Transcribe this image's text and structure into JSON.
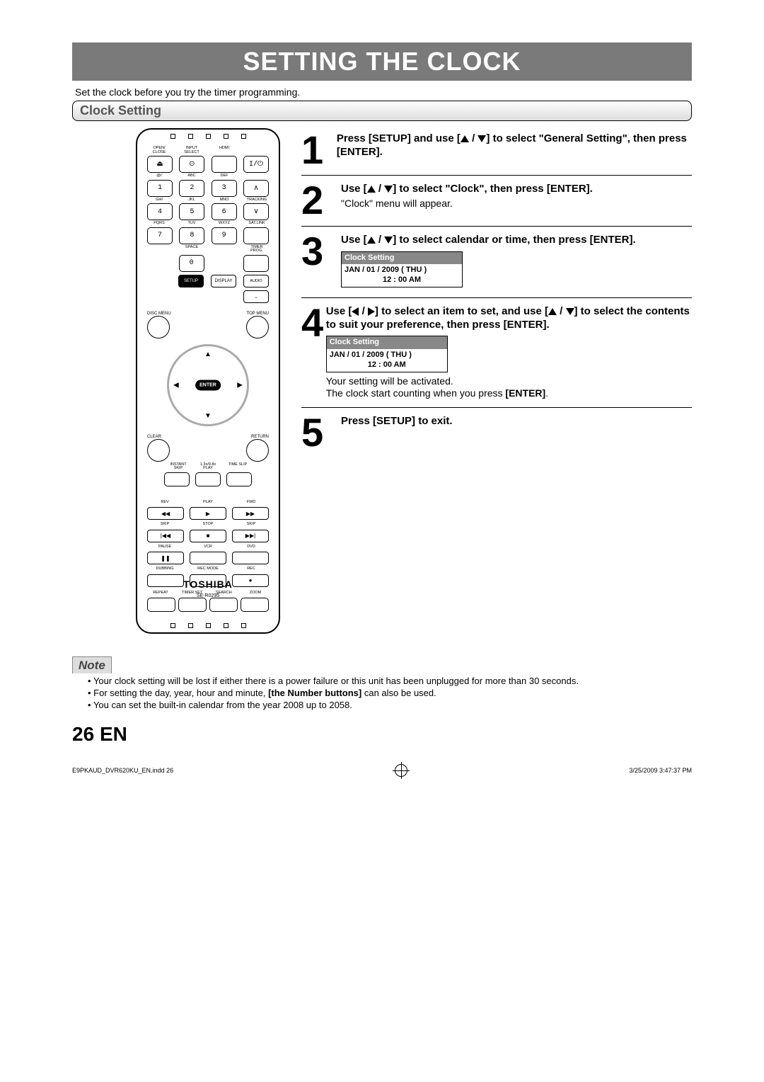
{
  "title": "SETTING THE CLOCK",
  "intro": "Set the clock before you try the timer programming.",
  "section_header": "Clock Setting",
  "remote": {
    "brand": "TOSHIBA",
    "model": "SE-R0295",
    "row1_labels": [
      "OPEN/\nCLOSE",
      "INPUT\nSELECT",
      "HDMI",
      ""
    ],
    "row1_icons": [
      "⏏",
      "⊙",
      "",
      "I/⏻"
    ],
    "num_labels1": [
      ".@/:",
      "ABC",
      "DEF",
      ""
    ],
    "nums1": [
      "1",
      "2",
      "3"
    ],
    "num_labels2": [
      "GHI",
      "JKL",
      "MNO",
      "TRACKING"
    ],
    "nums2": [
      "4",
      "5",
      "6"
    ],
    "num_labels3": [
      "PQRS",
      "TUV",
      "WXYZ",
      "SAT.LINK"
    ],
    "nums3": [
      "7",
      "8",
      "9"
    ],
    "zero_labels": [
      "",
      "SPACE",
      "",
      "TIMER\nPROG."
    ],
    "zero": "0",
    "setup_row": [
      "SETUP",
      "DISPLAY",
      "AUDIO"
    ],
    "disc_menu": "DISC MENU",
    "top_menu": "TOP MENU",
    "enter": "ENTER",
    "clear": "CLEAR",
    "return": "RETURN",
    "instant_labels": [
      "INSTANT\nSKIP",
      "1.3x/0.8x\nPLAY",
      "TIME SLIP"
    ],
    "transport_labels1": [
      "REV",
      "PLAY",
      "FWD"
    ],
    "transport_icons1": [
      "◀◀",
      "▶",
      "▶▶"
    ],
    "transport_labels2": [
      "SKIP",
      "STOP",
      "SKIP"
    ],
    "transport_icons2": [
      "|◀◀",
      "■",
      "▶▶|"
    ],
    "transport_labels3": [
      "PAUSE",
      "VCR",
      "DVD"
    ],
    "transport_icons3": [
      "❚❚",
      "",
      ""
    ],
    "transport_labels4": [
      "DUBBING",
      "REC MODE",
      "REC"
    ],
    "transport_icons4": [
      "",
      "",
      "●"
    ],
    "bottom_labels": [
      "REPEAT",
      "TIMER SET",
      "SEARCH",
      "ZOOM"
    ]
  },
  "steps": [
    {
      "num": "1",
      "parts": [
        "Press [SETUP] and use [",
        "UP",
        " / ",
        "DOWN",
        "] to select \"General Setting\", then press [ENTER]."
      ]
    },
    {
      "num": "2",
      "parts": [
        "Use [",
        "UP",
        " / ",
        "DOWN",
        "] to select \"Clock\", then press [ENTER]."
      ],
      "sub": "\"Clock\" menu will appear."
    },
    {
      "num": "3",
      "parts": [
        "Use [",
        "UP",
        " / ",
        "DOWN",
        "] to select calendar or time, then press [ENTER]."
      ],
      "osd": {
        "header": "Clock Setting",
        "line1": "JAN / 01 / 2009 ( THU )",
        "line2": "12 : 00 AM"
      }
    },
    {
      "num": "4",
      "parts": [
        "Use [",
        "LEFT",
        " / ",
        "RIGHT",
        "] to select an item to set, and use [",
        "UP",
        " / ",
        "DOWN",
        "] to select the contents to suit your preference, then press [ENTER]."
      ],
      "osd": {
        "header": "Clock Setting",
        "line1": "JAN / 01 / 2009 ( THU )",
        "line2": "12 : 00 AM"
      },
      "after": [
        "Your setting will be activated.",
        "The clock start counting when you press ",
        "[ENTER]",
        "."
      ]
    },
    {
      "num": "5",
      "parts": [
        "Press [SETUP] to exit."
      ]
    }
  ],
  "note_label": "Note",
  "notes": [
    "Your clock setting will be lost if either there is a power failure or this unit has been unplugged for more than 30 seconds.",
    "For setting the day, year, hour and minute, [the Number buttons] can also be used.",
    "You can set the built-in calendar from the year 2008 up to 2058."
  ],
  "notes_bold_phrase": "[the Number buttons]",
  "page_num": "26",
  "page_lang": "EN",
  "footer_left": "E9PKAUD_DVR620KU_EN.indd   26",
  "footer_right": "3/25/2009   3:47:37 PM"
}
